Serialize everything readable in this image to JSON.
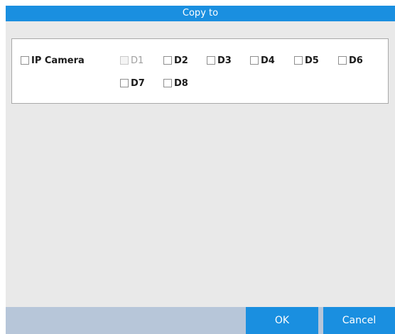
{
  "dialog": {
    "title": "Copy to"
  },
  "options": {
    "ip_camera": {
      "label": "IP Camera",
      "checked": false
    },
    "channels": [
      {
        "label": "D1",
        "checked": false,
        "disabled": true
      },
      {
        "label": "D2",
        "checked": false,
        "disabled": false
      },
      {
        "label": "D3",
        "checked": false,
        "disabled": false
      },
      {
        "label": "D4",
        "checked": false,
        "disabled": false
      },
      {
        "label": "D5",
        "checked": false,
        "disabled": false
      },
      {
        "label": "D6",
        "checked": false,
        "disabled": false
      },
      {
        "label": "D7",
        "checked": false,
        "disabled": false
      },
      {
        "label": "D8",
        "checked": false,
        "disabled": false
      }
    ]
  },
  "buttons": {
    "ok": "OK",
    "cancel": "Cancel"
  },
  "colors": {
    "accent": "#1a8fe0",
    "footer": "#b7c6d9",
    "background": "#e9e9e9"
  }
}
